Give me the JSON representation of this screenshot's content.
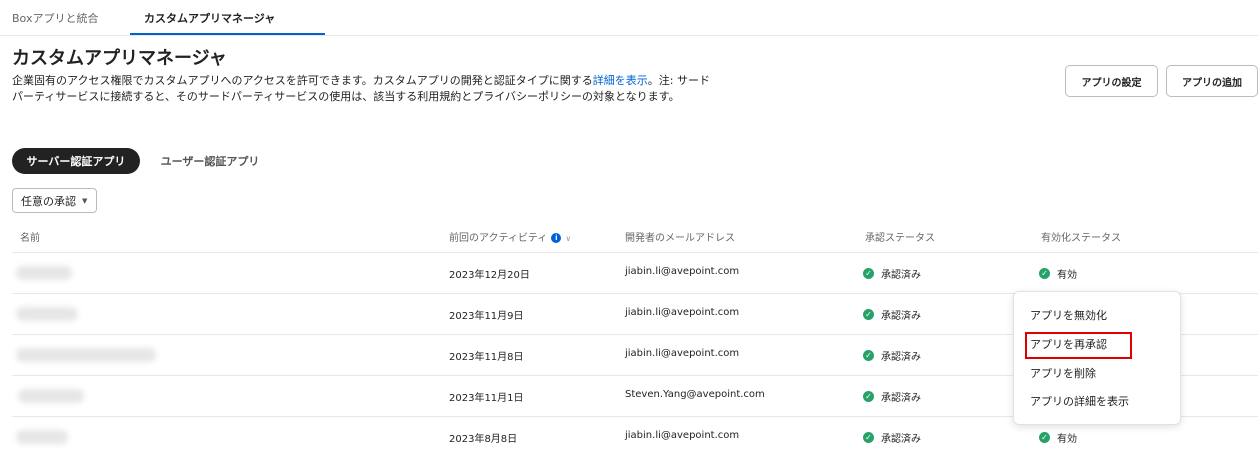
{
  "tabs": [
    {
      "label": "Boxアプリと統合"
    },
    {
      "label": "カスタムアプリマネージャ"
    }
  ],
  "page": {
    "title": "カスタムアプリマネージャ",
    "description_before_link": "企業固有のアクセス権限でカスタムアプリへのアクセスを許可できます。カスタムアプリの開発と認証タイプに関する",
    "description_link": "詳細を表示",
    "description_after_link": "。注: サードパーティサービスに接続すると、そのサードパーティサービスの使用は、該当する利用規約とプライバシーポリシーの対象となります。"
  },
  "buttons": {
    "settings": "アプリの設定",
    "add": "アプリの追加"
  },
  "segments": {
    "server": "サーバー認証アプリ",
    "user": "ユーザー認証アプリ"
  },
  "filter": {
    "label": "任意の承認"
  },
  "table": {
    "headers": {
      "name": "名前",
      "last_activity": "前回のアクティビティ",
      "developer_email": "開発者のメールアドレス",
      "approval_status": "承認ステータス",
      "enable_status": "有効化ステータス"
    },
    "rows": [
      {
        "date": "2023年12月20日",
        "email": "jiabin.li@avepoint.com",
        "approval": "承認済み",
        "enabled": "有効"
      },
      {
        "date": "2023年11月9日",
        "email": "jiabin.li@avepoint.com",
        "approval": "承認済み",
        "enabled": ""
      },
      {
        "date": "2023年11月8日",
        "email": "jiabin.li@avepoint.com",
        "approval": "承認済み",
        "enabled": ""
      },
      {
        "date": "2023年11月1日",
        "email": "Steven.Yang@avepoint.com",
        "approval": "承認済み",
        "enabled": ""
      },
      {
        "date": "2023年8月8日",
        "email": "jiabin.li@avepoint.com",
        "approval": "承認済み",
        "enabled": "有効"
      }
    ]
  },
  "menu": {
    "items": [
      {
        "label": "アプリを無効化"
      },
      {
        "label": "アプリを再承認"
      },
      {
        "label": "アプリを削除"
      },
      {
        "label": "アプリの詳細を表示"
      }
    ]
  },
  "colors": {
    "accent": "#0061d5",
    "success": "#26a269",
    "highlight": "#e00000"
  }
}
